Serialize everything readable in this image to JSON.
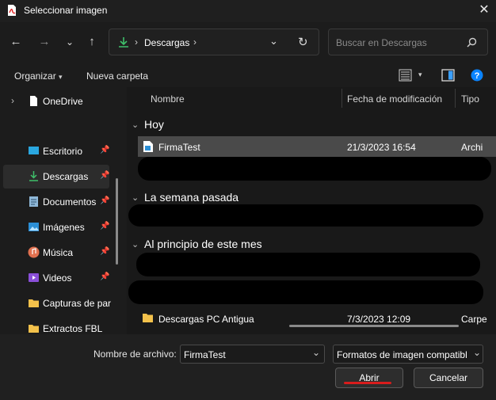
{
  "window": {
    "title": "Seleccionar imagen"
  },
  "nav": {
    "breadcrumb": [
      "Descargas"
    ]
  },
  "search": {
    "placeholder": "Buscar en Descargas"
  },
  "toolbar": {
    "organize": "Organizar",
    "new_folder": "Nueva carpeta"
  },
  "sidebar": {
    "items": [
      {
        "label": "OneDrive"
      },
      {
        "label": "Escritorio"
      },
      {
        "label": "Descargas"
      },
      {
        "label": "Documentos"
      },
      {
        "label": "Imágenes"
      },
      {
        "label": "Música"
      },
      {
        "label": "Videos"
      },
      {
        "label": "Capturas de par"
      },
      {
        "label": "Extractos FBL"
      }
    ]
  },
  "columns": {
    "name": "Nombre",
    "modified": "Fecha de modificación",
    "type": "Tipo"
  },
  "groups": [
    {
      "title": "Hoy"
    },
    {
      "title": "La semana pasada"
    },
    {
      "title": "Al principio de este mes"
    }
  ],
  "files": [
    {
      "name": "FirmaTest",
      "date": "21/3/2023 16:54",
      "type": "Archi"
    },
    {
      "name": "Descargas PC Antigua",
      "date": "7/3/2023 12:09",
      "type": "Carpe"
    }
  ],
  "footer": {
    "filename_label": "Nombre de archivo:",
    "filename_value": "FirmaTest",
    "filetype_value": "Formatos de imagen compatibl",
    "open": "Abrir",
    "cancel": "Cancelar"
  },
  "colors": {
    "accent": "#0a84ff",
    "highlight": "#d81c1c",
    "download_green": "#3fbf6a",
    "folder": "#f3c14b"
  }
}
